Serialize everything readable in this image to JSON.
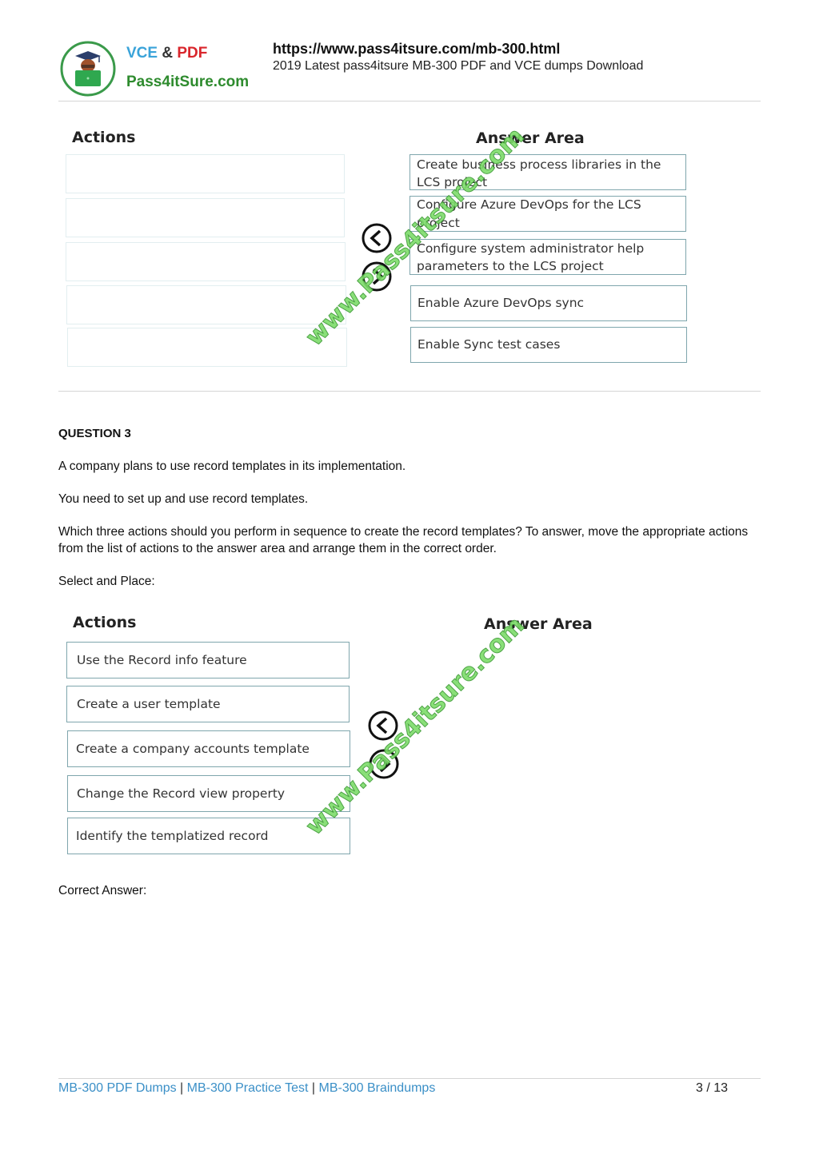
{
  "header": {
    "brand_line1_part1": "VCE",
    "brand_line1_part2": "&",
    "brand_line1_part3": "PDF",
    "brand_line2": "Pass4itSure.com",
    "url": "https://www.pass4itsure.com/mb-300.html",
    "subtitle": "2019 Latest pass4itsure MB-300 PDF and VCE dumps Download",
    "logo_icon": "student-laptop-icon"
  },
  "figure1": {
    "actions_title": "Actions",
    "answer_title": "Answer Area",
    "actions_items": [
      "",
      "",
      "",
      "",
      ""
    ],
    "answer_items": [
      "Create business process libraries in the LCS project",
      "Configure Azure DevOps for the LCS project",
      "Configure system administrator help parameters to the LCS project",
      "Enable Azure DevOps sync",
      "Enable Sync test cases"
    ],
    "watermark": "www.Pass4itsure.com"
  },
  "question": {
    "title": "QUESTION 3",
    "line1": "A company plans to use record templates in its implementation.",
    "line2": "You need to set up and use record templates.",
    "line3": "Which three actions should you perform in sequence to create the record templates? To answer, move the appropriate actions from the list of actions to the answer area and arrange them in the correct order.",
    "line4": "Select and Place:",
    "correct_answer_label": "Correct Answer:"
  },
  "figure2": {
    "actions_title": "Actions",
    "answer_title": "Answer Area",
    "actions_items": [
      "Use the Record info feature",
      "Create a user template",
      "Create a company accounts template",
      "Change the Record view property",
      "Identify the templatized record"
    ],
    "watermark": "www.Pass4itsure.com"
  },
  "footer": {
    "link1": "MB-300 PDF Dumps",
    "link2": "MB-300 Practice Test",
    "link3": "MB-300 Braindumps",
    "separator": "|",
    "page": "3 / 13"
  }
}
